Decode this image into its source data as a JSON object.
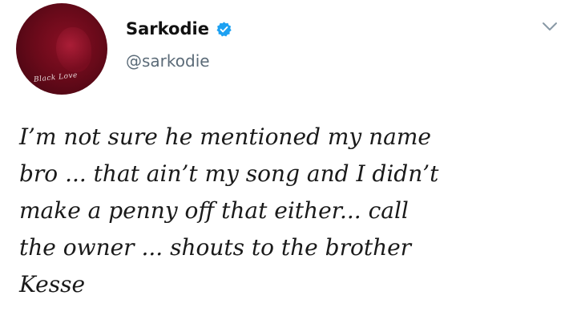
{
  "tweet": {
    "author": {
      "display_name": "Sarkodie",
      "handle": "@sarkodie",
      "verified": true,
      "verified_icon": "verified-badge-icon",
      "verified_color": "#1da1f2",
      "avatar_signature": "Black Love"
    },
    "menu_icon": "chevron-down-icon",
    "text_lines": [
      "I’m not sure he mentioned my name",
      "bro ... that ain’t my song and I didn’t",
      "make a penny off that either... call",
      "the owner ... shouts to the brother",
      "Kesse"
    ]
  }
}
